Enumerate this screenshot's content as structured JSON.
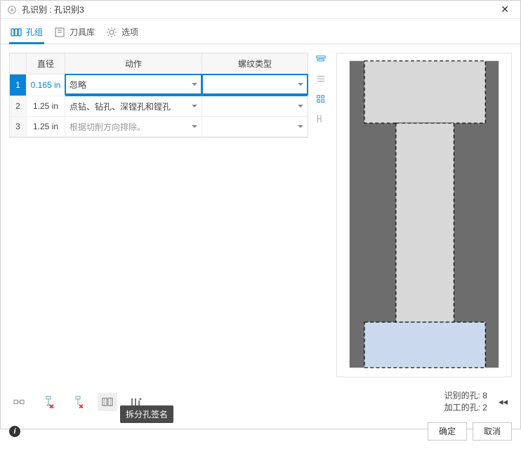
{
  "window": {
    "title": "孔识别 : 孔识别3"
  },
  "tabs": [
    {
      "label": "孔组",
      "icon": "holes-icon"
    },
    {
      "label": "刀具库",
      "icon": "tool-library-icon"
    },
    {
      "label": "选项",
      "icon": "gear-icon"
    }
  ],
  "table": {
    "headers": {
      "diameter": "直径",
      "action": "动作",
      "thread": "螺纹类型"
    },
    "rows": [
      {
        "idx": "1",
        "diameter": "0.165 in",
        "action": "忽略",
        "thread": "",
        "selected": true
      },
      {
        "idx": "2",
        "diameter": "1.25 in",
        "action": "点钻、钻孔、深镗孔和镗孔",
        "thread": ""
      },
      {
        "idx": "3",
        "diameter": "1.25 in",
        "action": "根据切削方向排除。",
        "thread": ""
      }
    ]
  },
  "status": {
    "recognized_label": "识别的孔:",
    "recognized_count": "8",
    "machined_label": "加工的孔:",
    "machined_count": "2"
  },
  "tooltip": "拆分孔签名",
  "buttons": {
    "ok": "确定",
    "cancel": "取消"
  }
}
